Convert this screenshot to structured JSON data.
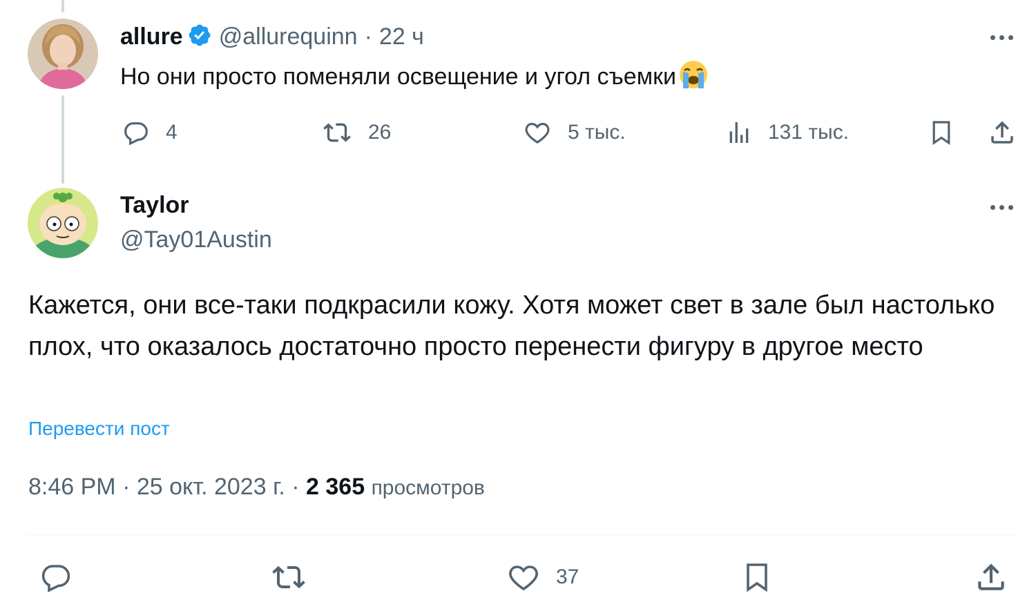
{
  "reply": {
    "display_name": "allure",
    "handle": "@allurequinn",
    "separator": "·",
    "time": "22 ч",
    "text": "Но они просто поменяли освещение и угол съемки",
    "emoji": "loudly-crying-face",
    "actions": {
      "replies": "4",
      "reposts": "26",
      "likes": "5 тыс.",
      "views": "131 тыс."
    }
  },
  "main": {
    "display_name": "Taylor",
    "handle": "@Tay01Austin",
    "text": "Кажется, они все-таки подкрасили кожу. Хотя может свет в зале был настолько плох, что оказалось достаточно просто перенести фигуру в другое место",
    "translate_label": "Перевести пост",
    "time": "8:46 PM",
    "sep1": "·",
    "date": "25 окт. 2023 г.",
    "sep2": "·",
    "views_count": "2 365",
    "views_label": "просмотров",
    "actions": {
      "likes": "37"
    }
  },
  "colors": {
    "text": "#0f1419",
    "secondary": "#536471",
    "link": "#1d9bf0",
    "verified": "#1d9bf0"
  }
}
